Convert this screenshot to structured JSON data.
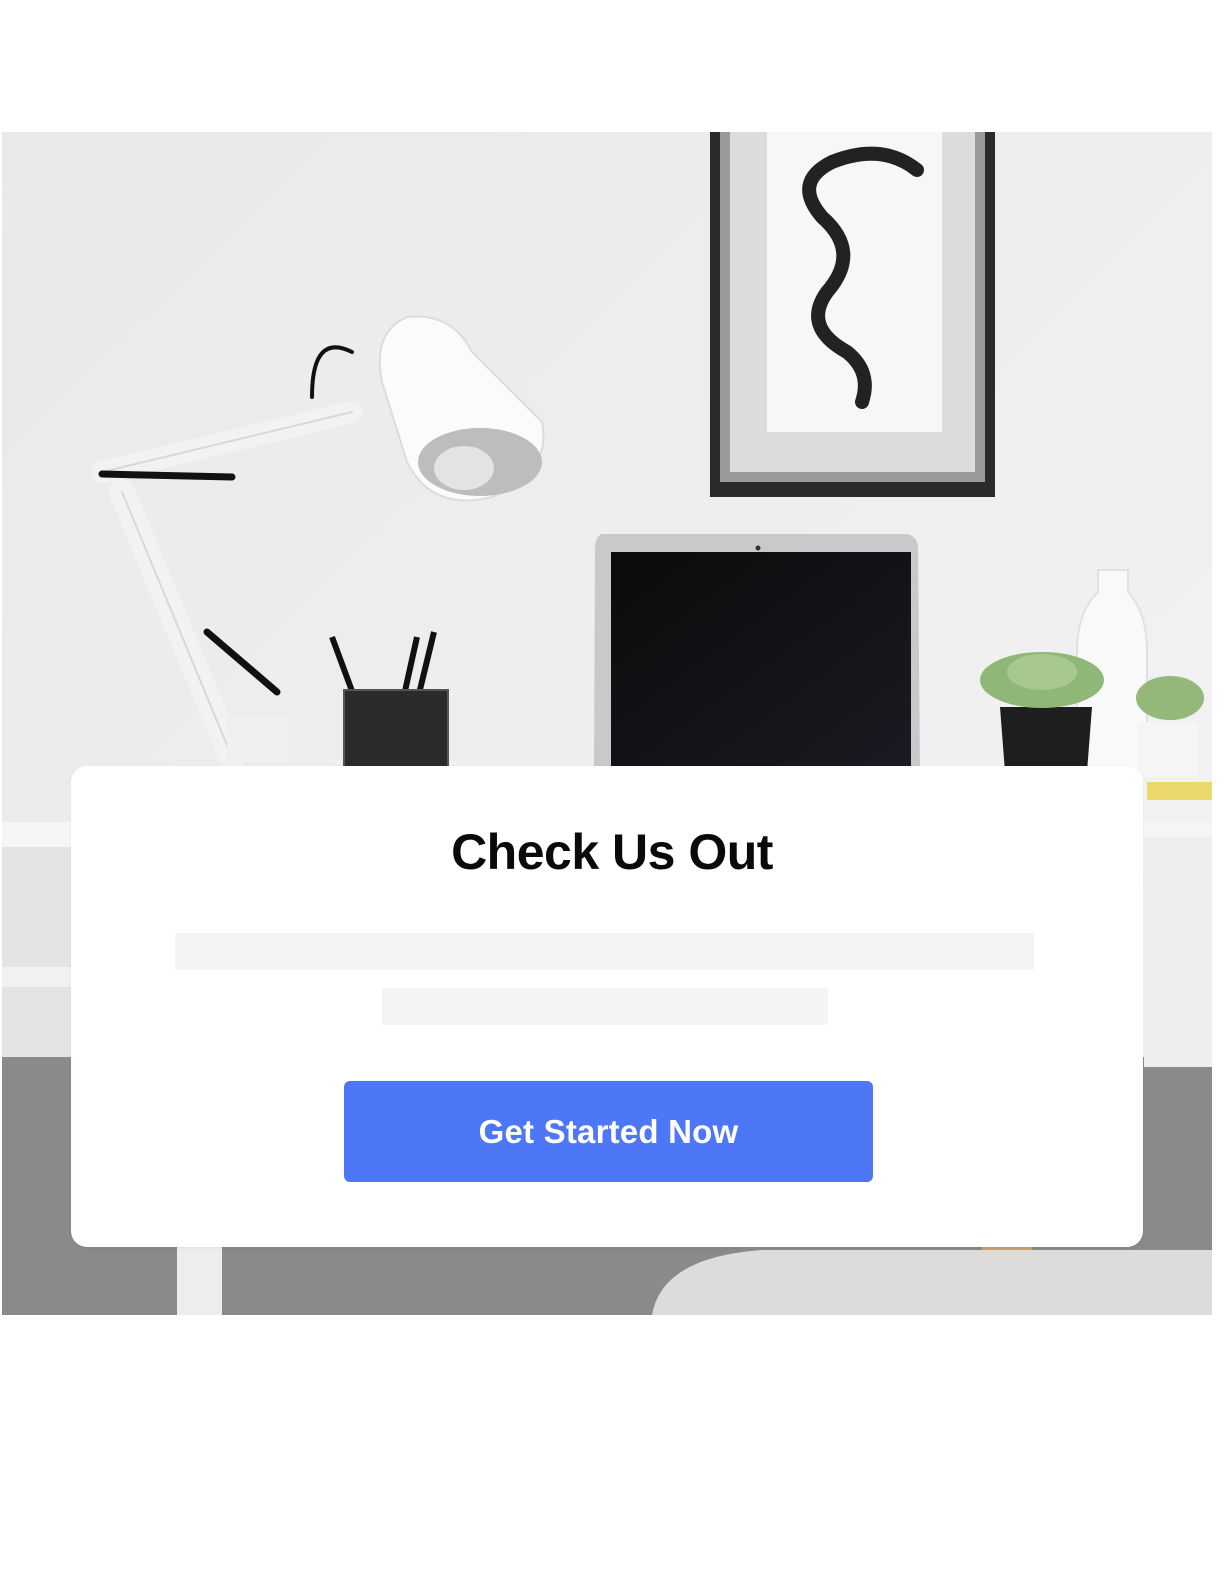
{
  "card": {
    "title": "Check Us Out",
    "cta_label": "Get Started Now"
  },
  "colors": {
    "accent": "#4d77f7",
    "placeholder": "#f3f4f6",
    "card_background": "#ffffff"
  },
  "hero": {
    "icon": "desk-workspace-photo"
  }
}
